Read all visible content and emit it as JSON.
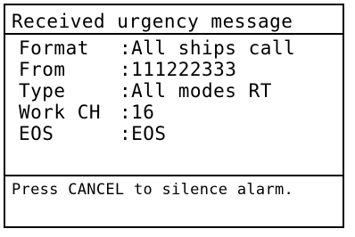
{
  "title": "Received urgency message",
  "fields": [
    {
      "label": "Format",
      "value": ":All ships call"
    },
    {
      "label": "From",
      "value": ":111222333"
    },
    {
      "label": "Type",
      "value": ":All modes RT"
    },
    {
      "label": "Work CH",
      "value": ":16"
    },
    {
      "label": "EOS",
      "value": ":EOS"
    }
  ],
  "footer": "Press CANCEL to silence alarm.",
  "colors": {
    "foreground": "#000000",
    "background": "#ffffff"
  }
}
